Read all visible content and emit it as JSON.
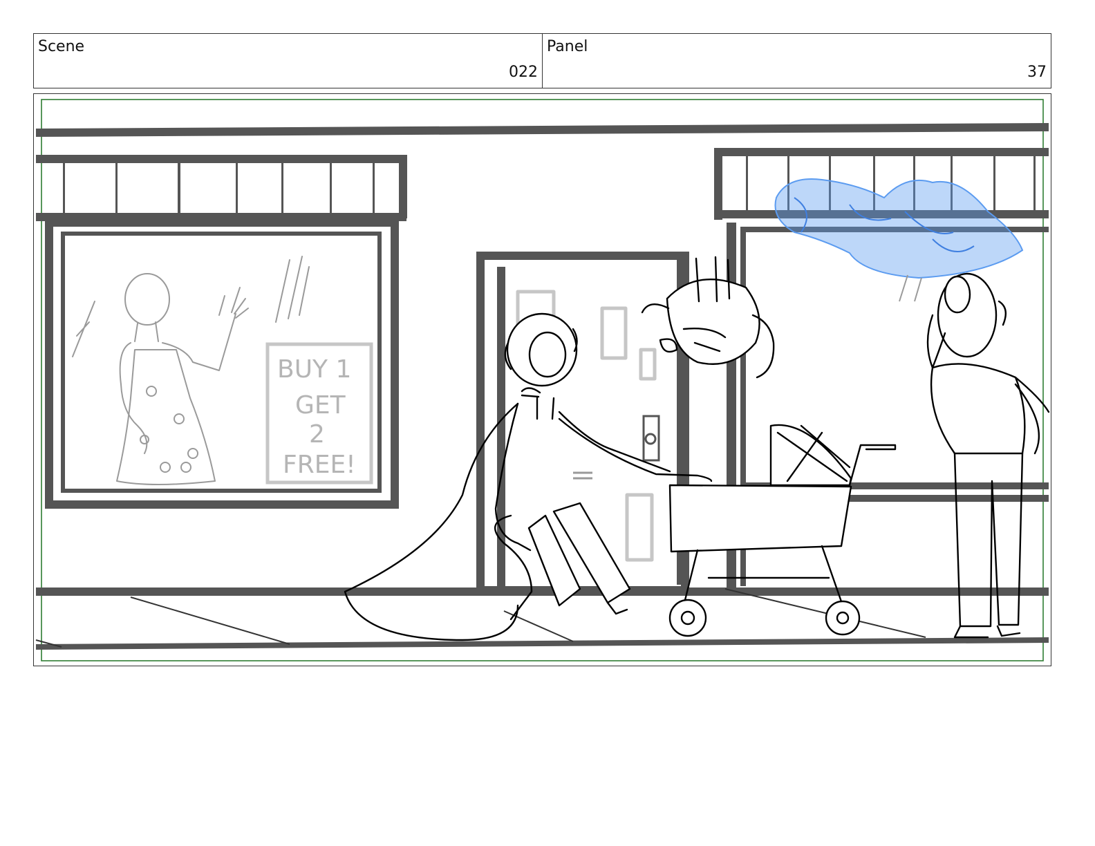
{
  "header": {
    "scene_label": "Scene",
    "scene_number": "022",
    "panel_label": "Panel",
    "panel_number": "37"
  },
  "drawing": {
    "sign_lines": [
      "BUY 1",
      "GET",
      "2",
      "FREE!"
    ],
    "safe_frame_color": "#2e7d32",
    "cloud_color": "#5b9bf0"
  }
}
